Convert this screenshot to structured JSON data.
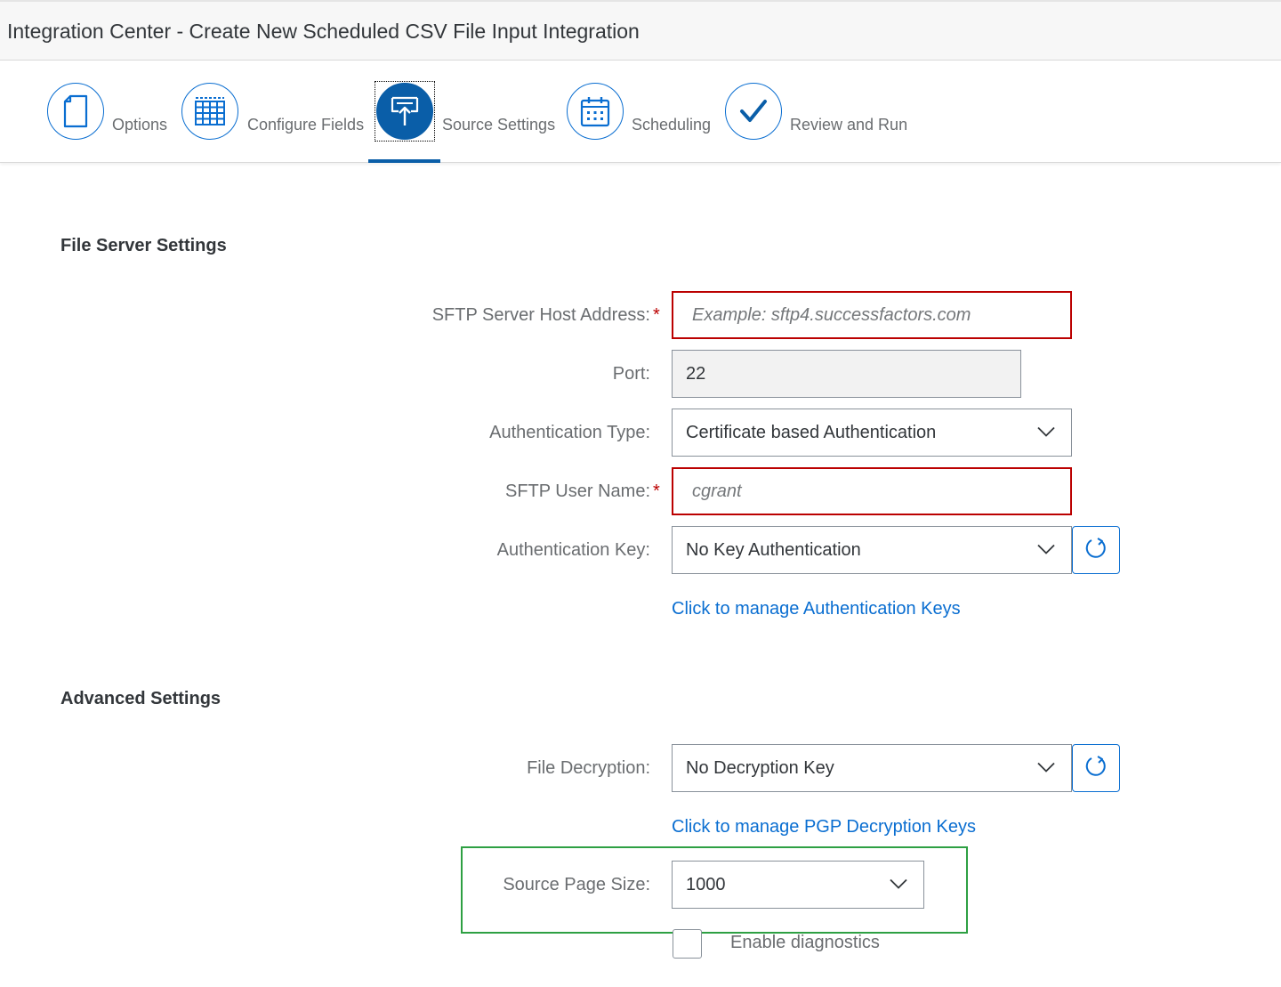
{
  "window": {
    "title": "Integration Center - Create New Scheduled CSV File Input Integration"
  },
  "wizard": {
    "steps": [
      {
        "label": "Options",
        "icon": "document-icon"
      },
      {
        "label": "Configure Fields",
        "icon": "table-grid-icon"
      },
      {
        "label": "Source Settings",
        "icon": "upload-icon",
        "active": true
      },
      {
        "label": "Scheduling",
        "icon": "calendar-icon"
      },
      {
        "label": "Review and Run",
        "icon": "checkmark-icon"
      }
    ],
    "accent_color": "#0a5ea8"
  },
  "file_server": {
    "heading": "File Server Settings",
    "host": {
      "label": "SFTP Server Host Address:",
      "required": "*",
      "value": "",
      "placeholder": "Example: sftp4.successfactors.com"
    },
    "port": {
      "label": "Port:",
      "value": "22"
    },
    "auth_type": {
      "label": "Authentication Type:",
      "value": "Certificate based Authentication"
    },
    "username": {
      "label": "SFTP User Name:",
      "required": "*",
      "value": "",
      "placeholder": "cgrant"
    },
    "auth_key": {
      "label": "Authentication Key:",
      "value": "No Key Authentication"
    },
    "manage_keys_link": "Click to manage Authentication Keys"
  },
  "advanced": {
    "heading": "Advanced Settings",
    "decryption": {
      "label": "File Decryption:",
      "value": "No Decryption Key"
    },
    "manage_pgp_link": "Click to manage PGP Decryption Keys",
    "page_size": {
      "label": "Source Page Size:",
      "value": "1000"
    },
    "diagnostics": {
      "label": "Enable diagnostics",
      "checked": false
    }
  },
  "colors": {
    "error_border": "#bb0000",
    "link": "#0a6ed1",
    "highlight": "#2ea043"
  }
}
